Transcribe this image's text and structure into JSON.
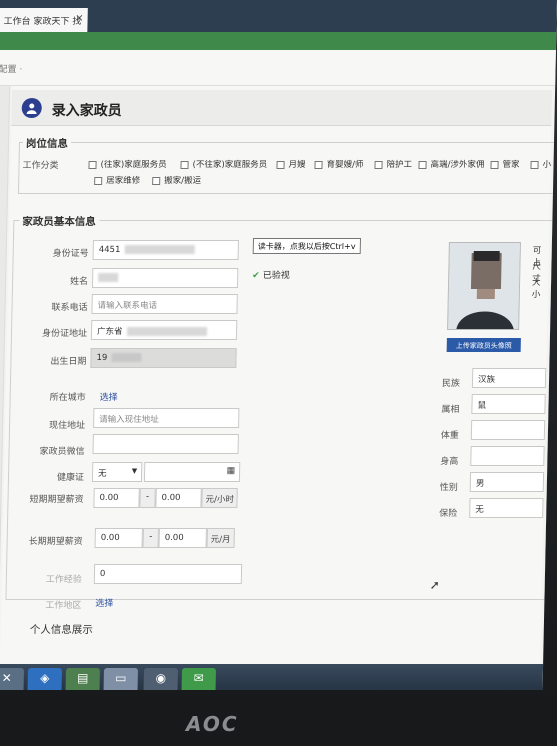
{
  "browser": {
    "tab_label": "工作台 家政天下 找",
    "tab_close": "×"
  },
  "menubar": {
    "settings_label": "配置 ·"
  },
  "page": {
    "title": "录入家政员"
  },
  "job_section": {
    "title": "岗位信息",
    "category_label": "工作分类",
    "options_row1": [
      "(往家)家庭服务员",
      "(不往家)家庭服务员",
      "月嫂",
      "育婴嫂/师",
      "陪护工",
      "高端/涉外家佣",
      "管家",
      "小"
    ],
    "options_row2": [
      "居家维修",
      "搬家/搬运"
    ]
  },
  "basic_section": {
    "title": "家政员基本信息",
    "id_label": "身份证号",
    "id_value": "4451",
    "read_card_button": "读卡器，点我以后按Ctrl+v",
    "verified_text": "已验视",
    "name_label": "姓名",
    "phone_label": "联系电话",
    "phone_placeholder": "请输入联系电话",
    "address_label": "身份证地址",
    "address_value": "广东省",
    "birth_label": "出生日期",
    "birth_value": "19",
    "city_label": "所在城市",
    "city_link": "选择",
    "current_address_label": "现住地址",
    "current_address_placeholder": "请输入现住地址",
    "wechat_label": "家政员微信",
    "health_label": "健康证",
    "health_value": "无",
    "short_salary_label": "短期期望薪资",
    "short_min": "0.00",
    "short_max": "0.00",
    "short_unit": "元/小时",
    "dash": "-",
    "long_salary_label": "长期期望薪资",
    "long_min": "0.00",
    "long_max": "0.00",
    "long_unit": "元/月",
    "experience_label": "工作经验",
    "experience_value": "0",
    "area_label": "工作地区",
    "area_link": "选择",
    "upload_avatar_button": "上传家政员头像照",
    "side_note_1": "可上",
    "side_note_2": "尺寸",
    "side_note_3": "大小",
    "ethnicity_label": "民族",
    "ethnicity_value": "汉族",
    "zodiac_label": "属相",
    "zodiac_value": "鼠",
    "weight_label": "体重",
    "height_label": "身高",
    "gender_label": "性别",
    "gender_value": "男",
    "insurance_label": "保险",
    "insurance_value": "无"
  },
  "personal_section": {
    "title": "个人信息展示"
  },
  "monitor": {
    "brand": "AOC"
  }
}
